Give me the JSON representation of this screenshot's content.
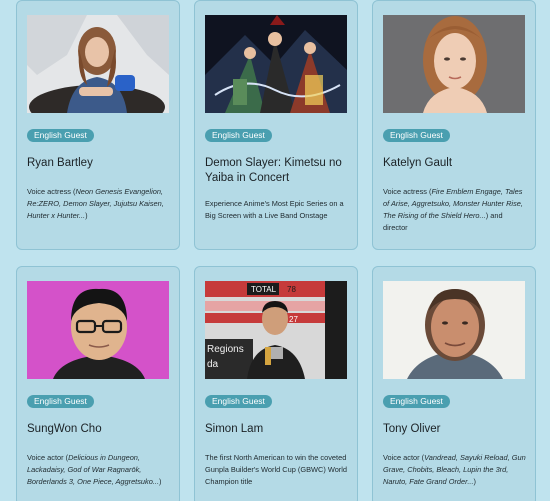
{
  "guests": [
    {
      "badge": "English Guest",
      "name": "Ryan Bartley",
      "desc_prefix": "Voice actress (",
      "desc_italic": "Neon Genesis Evangelion, Re:ZERO, Demon Slayer, Jujutsu Kaisen, Hunter x Hunter...",
      "desc_suffix": ")"
    },
    {
      "badge": "English Guest",
      "name": "Demon Slayer: Kimetsu no Yaiba in Concert",
      "desc_prefix": "Experience Anime's Most Epic Series on a Big Screen with a Live Band Onstage",
      "desc_italic": "",
      "desc_suffix": ""
    },
    {
      "badge": "English Guest",
      "name": "Katelyn Gault",
      "desc_prefix": "Voice actress (",
      "desc_italic": "Fire Emblem Engage, Tales of Arise, Aggretsuko, Monster Hunter Rise, The Rising of the Shield Hero...",
      "desc_suffix": ") and director"
    },
    {
      "badge": "English Guest",
      "name": "SungWon Cho",
      "desc_prefix": "Voice actor (",
      "desc_italic": "Delicious in Dungeon, Lackadaisy, God of War Ragnarök, Borderlands 3, One Piece, Aggretsuko...",
      "desc_suffix": ")"
    },
    {
      "badge": "English Guest",
      "name": "Simon Lam",
      "desc_prefix": "The first North American to win the coveted Gunpla Builder's World Cup (GBWC) World Champion title",
      "desc_italic": "",
      "desc_suffix": ""
    },
    {
      "badge": "English Guest",
      "name": "Tony Oliver",
      "desc_prefix": "Voice actor (",
      "desc_italic": "Vandread, Sayuki Reload, Gun Grave, Chobits, Bleach, Lupin the 3rd, Naruto, Fate Grand Order...",
      "desc_suffix": ")"
    }
  ],
  "photo_text": {
    "total": "TOTAL",
    "num78": "78",
    "num27": "27",
    "regions": "Regions",
    "da": "da"
  },
  "colors": {
    "page_bg": "#bfe3ee",
    "card_bg": "#b4dae6",
    "badge_bg": "#4a9fb0"
  }
}
